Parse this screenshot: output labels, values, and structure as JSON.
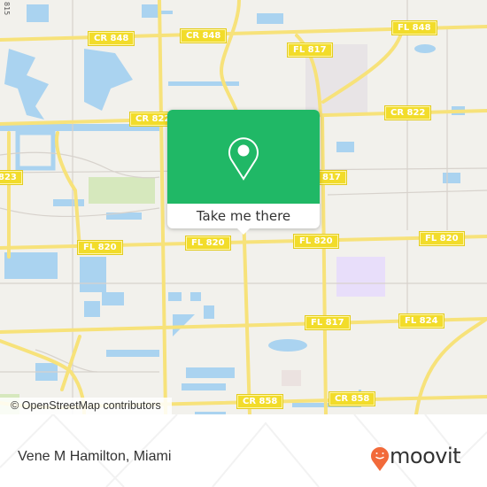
{
  "map": {
    "road_labels": [
      {
        "id": "cr848-a",
        "text": "CR 848"
      },
      {
        "id": "cr848-b",
        "text": "CR 848"
      },
      {
        "id": "fl848",
        "text": "FL 848"
      },
      {
        "id": "fl817-top",
        "text": "FL 817"
      },
      {
        "id": "cr822-left",
        "text": "CR 822"
      },
      {
        "id": "cr822-right",
        "text": "CR 822"
      },
      {
        "id": "label-823",
        "text": "823"
      },
      {
        "id": "fl817-mid",
        "text": "817"
      },
      {
        "id": "fl820-a",
        "text": "FL 820"
      },
      {
        "id": "fl820-b",
        "text": "FL 820"
      },
      {
        "id": "fl820-c",
        "text": "FL 820"
      },
      {
        "id": "fl820-d",
        "text": "FL 820"
      },
      {
        "id": "fl817-low",
        "text": "FL 817"
      },
      {
        "id": "fl824",
        "text": "FL 824"
      },
      {
        "id": "cr858-a",
        "text": "CR 858"
      },
      {
        "id": "cr858-b",
        "text": "CR 858"
      }
    ],
    "edge_label": "815",
    "attribution": "© OpenStreetMap contributors",
    "colors": {
      "land": "#f2f1ec",
      "water": "#aad3f0",
      "road": "#f7e27a",
      "park": "#d6e8bd",
      "label_bg": "#f2dc2a"
    }
  },
  "popup": {
    "icon": "map-pin-icon",
    "button_label": "Take me there",
    "color": "#20b866"
  },
  "footer": {
    "place_name": "Vene M Hamilton, Miami",
    "brand": "moovit",
    "brand_color": "#f26a3a"
  }
}
